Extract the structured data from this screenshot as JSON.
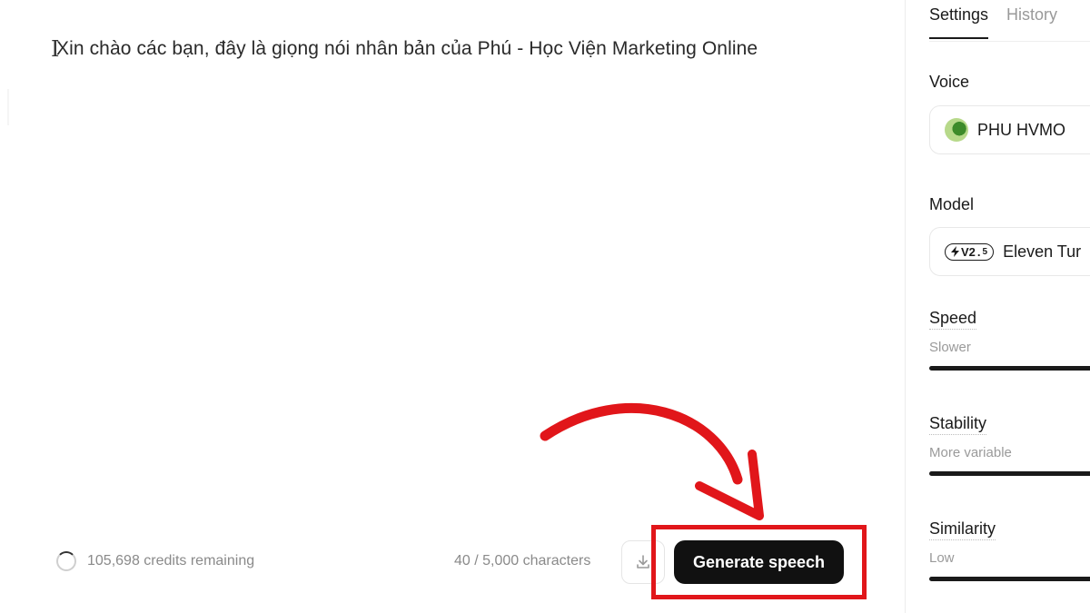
{
  "editor": {
    "text": "Xin chào các bạn, đây là giọng nói nhân bản của Phú - Học Viện Marketing Online",
    "cursor_glyph": "I"
  },
  "footer": {
    "credits_text": "105,698 credits remaining",
    "char_count": "40 / 5,000 characters",
    "generate_label": "Generate speech",
    "download_icon": "download-icon"
  },
  "sidebar": {
    "tabs": [
      {
        "label": "Settings",
        "active": true
      },
      {
        "label": "History",
        "active": false
      }
    ],
    "voice": {
      "label": "Voice",
      "value": "PHU HVMO"
    },
    "model": {
      "label": "Model",
      "badge": "V2",
      "badge_sub": "5",
      "value": "Eleven Tur"
    },
    "sliders": [
      {
        "label": "Speed",
        "hint": "Slower"
      },
      {
        "label": "Stability",
        "hint": "More variable"
      },
      {
        "label": "Similarity",
        "hint": "Low"
      }
    ]
  },
  "colors": {
    "accent_highlight": "#e1161a",
    "button_bg": "#111111"
  }
}
